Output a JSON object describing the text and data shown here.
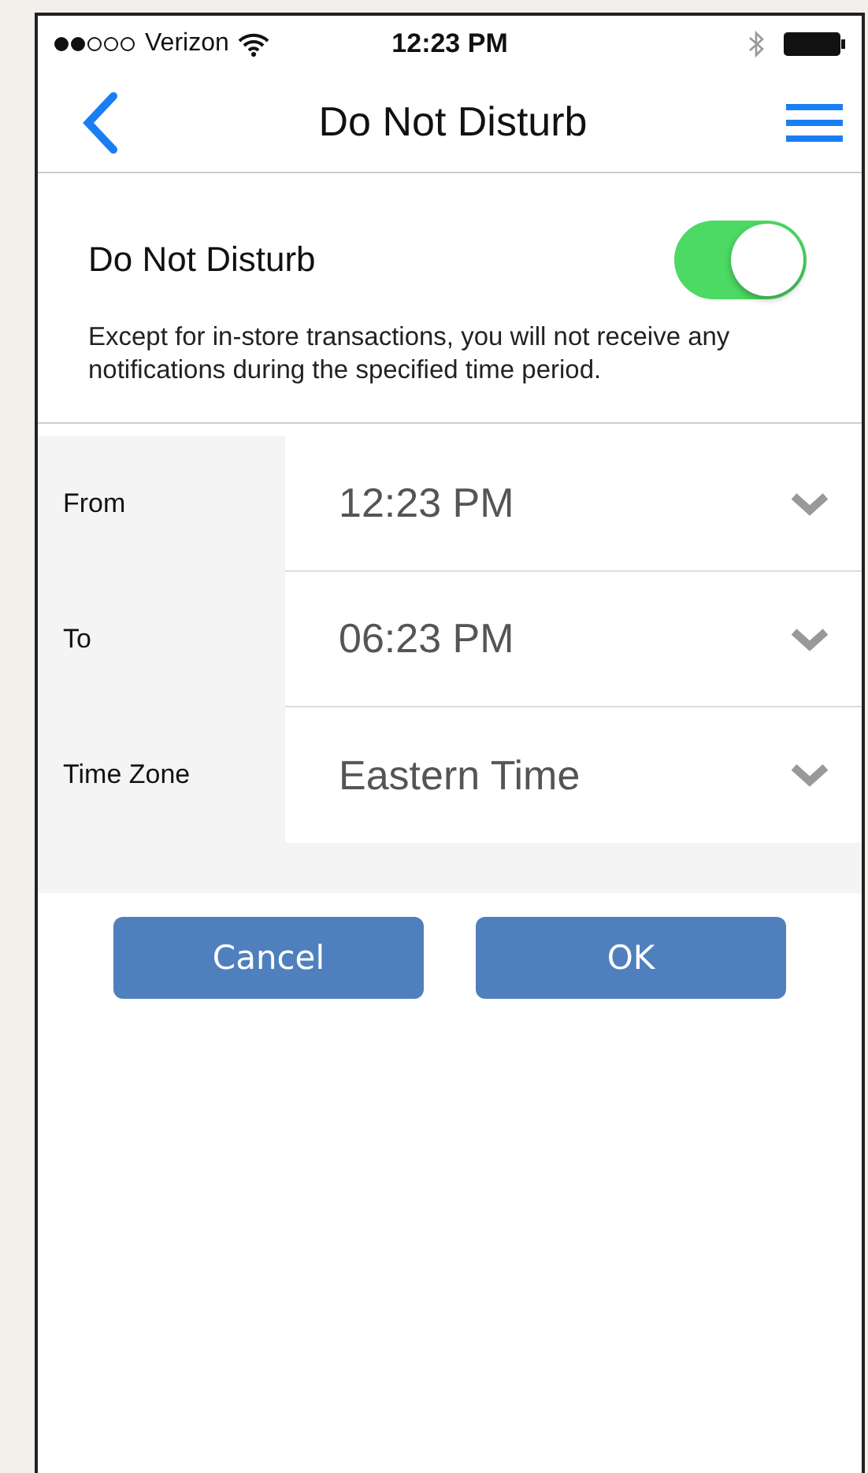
{
  "status_bar": {
    "carrier": "Verizon",
    "time": "12:23 PM"
  },
  "nav": {
    "title": "Do Not Disturb"
  },
  "setting": {
    "label": "Do Not Disturb",
    "on": true,
    "description": "Except for in-store transactions, you will not receive any notifications during the specified time period."
  },
  "fields": [
    {
      "label": "From",
      "value": "12:23 PM"
    },
    {
      "label": "To",
      "value": "06:23 PM"
    },
    {
      "label": "Time Zone",
      "value": "Eastern Time"
    }
  ],
  "buttons": [
    {
      "label": "Cancel"
    },
    {
      "label": "OK"
    }
  ]
}
